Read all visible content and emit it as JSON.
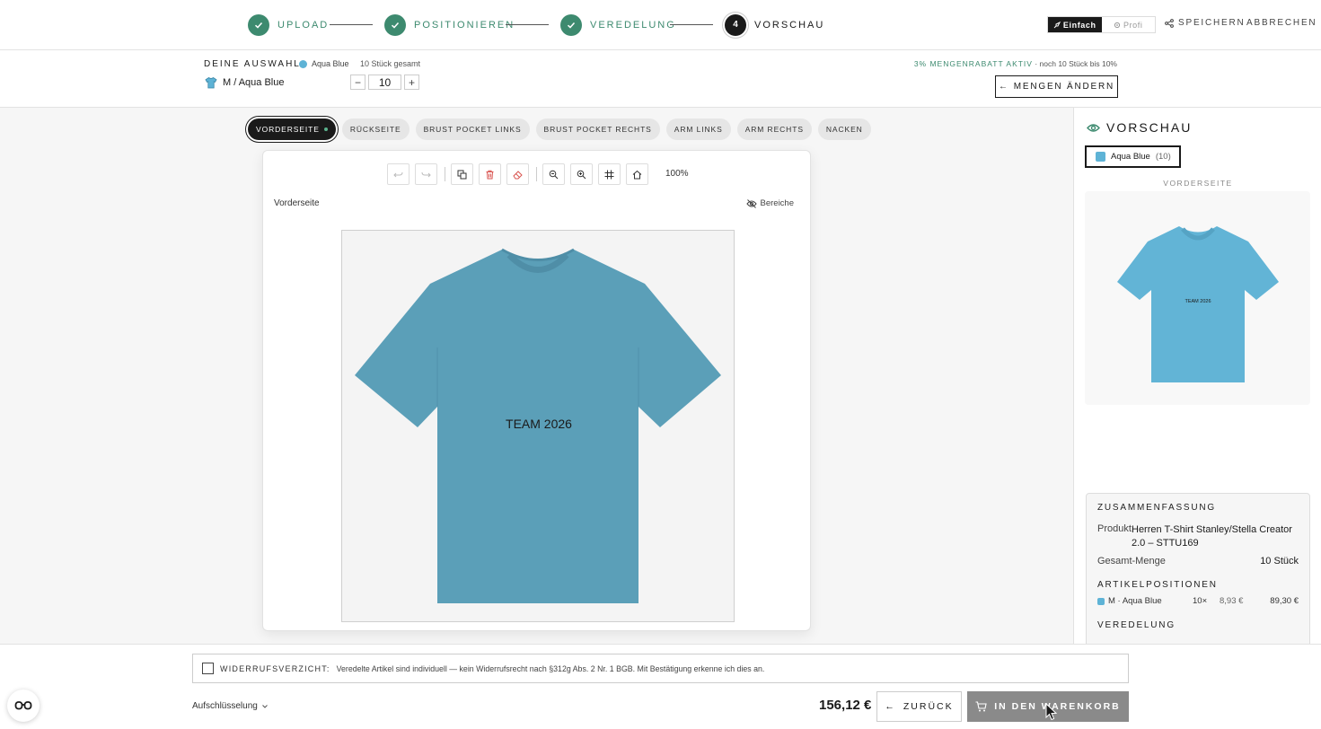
{
  "steps": [
    {
      "label": "UPLOAD",
      "state": "done"
    },
    {
      "label": "POSITIONIEREN",
      "state": "done"
    },
    {
      "label": "VEREDELUNG",
      "state": "done"
    },
    {
      "label": "VORSCHAU",
      "state": "active",
      "number": "4"
    }
  ],
  "header": {
    "mode_simple": "Einfach",
    "mode_pro": "Profi",
    "save_label": "SPEICHERN",
    "cancel_label": "ABBRECHEN"
  },
  "selection": {
    "title": "DEINE AUSWAHL",
    "color_name": "Aqua Blue",
    "total_pieces": "10 Stück gesamt",
    "variant_label": "M / Aqua Blue",
    "quantity": "10",
    "discount_active": "3% MENGENRABATT AKTIV",
    "discount_hint": " · noch 10 Stück bis 10%",
    "change_quantities_label": "MENGEN ÄNDERN"
  },
  "side_tabs": [
    "VORDERSEITE",
    "RÜCKSEITE",
    "BRUST POCKET LINKS",
    "BRUST POCKET RECHTS",
    "ARM LINKS",
    "ARM RECHTS",
    "NACKEN"
  ],
  "editor": {
    "zoom": "100%",
    "side_title": "Vorderseite",
    "areas_label": "Bereiche",
    "print_text": "TEAM 2026"
  },
  "preview": {
    "title": "VORSCHAU",
    "color_chip": "Aqua Blue",
    "color_count": "(10)",
    "side_label": "VORDERSEITE",
    "print_text": "TEAM 2026"
  },
  "summary": {
    "title": "ZUSAMMENFASSUNG",
    "product_label": "Produkt",
    "product_value": "Herren T-Shirt Stanley/Stella Creator 2.0 – STTU169",
    "quantity_label": "Gesamt-Menge",
    "quantity_value": "10 Stück",
    "positions_title": "ARTIKELPOSITIONEN",
    "positions": [
      {
        "name": "M · Aqua Blue",
        "qty": "10×",
        "unit": "8,93 €",
        "total": "89,30 €"
      }
    ],
    "finishing_title": "VEREDELUNG"
  },
  "footer": {
    "waiver_title": "WIDERRUFSVERZICHT:",
    "waiver_text": "Veredelte Artikel sind individuell — kein Widerrufsrecht nach §312g Abs. 2 Nr. 1 BGB. Mit Bestätigung erkenne ich dies an.",
    "breakdown_label": "Aufschlüsselung",
    "total_price": "156,12 €",
    "back_label": "ZURÜCK",
    "cart_label": "IN DEN WARENKORB"
  },
  "colors": {
    "accent_green": "#3d8a6f",
    "shirt_aqua": "#5b9fb8",
    "swatch_aqua": "#5eb3d6",
    "dark": "#1a1a1a"
  }
}
